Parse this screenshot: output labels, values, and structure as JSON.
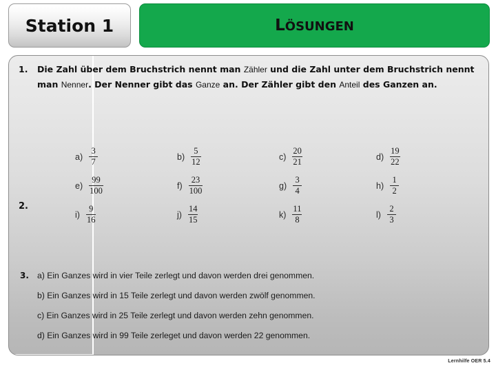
{
  "header": {
    "station_label": "Station 1",
    "solutions_label_first": "L",
    "solutions_label_rest": "ÖSUNGEN",
    "green_color": "#14a84c"
  },
  "section1": {
    "number": "1.",
    "text_part1": "Die Zahl über dem Bruchstrich nennt man ",
    "answer1": "Zähler",
    "text_part2": " und die Zahl unter dem Bruchstrich nennt man ",
    "answer2": "Nenner",
    "text_part3": ". Der Nenner gibt das ",
    "answer3": "Ganze",
    "text_part4": " an. Der Zähler gibt den ",
    "answer4": "Anteil",
    "text_part5": " des Ganzen an."
  },
  "section2": {
    "number": "2.",
    "rows": [
      [
        {
          "label": "a)",
          "numerator": "3",
          "denominator": "7"
        },
        {
          "label": "b)",
          "numerator": "5",
          "denominator": "12"
        },
        {
          "label": "c)",
          "numerator": "20",
          "denominator": "21"
        },
        {
          "label": "d)",
          "numerator": "19",
          "denominator": "22"
        }
      ],
      [
        {
          "label": "e)",
          "numerator": "99",
          "denominator": "100"
        },
        {
          "label": "f)",
          "numerator": "23",
          "denominator": "100"
        },
        {
          "label": "g)",
          "numerator": "3",
          "denominator": "4"
        },
        {
          "label": "h)",
          "numerator": "1",
          "denominator": "2"
        }
      ],
      [
        {
          "label": "i)",
          "numerator": "9",
          "denominator": "16"
        },
        {
          "label": "j)",
          "numerator": "14",
          "denominator": "15"
        },
        {
          "label": "k)",
          "numerator": "11",
          "denominator": "8"
        },
        {
          "label": "l)",
          "numerator": "2",
          "denominator": "3"
        }
      ]
    ]
  },
  "section3": {
    "number": "3.",
    "lines": [
      "a) Ein Ganzes wird in vier Teile zerlegt und davon werden drei genommen.",
      "b) Ein Ganzes wird in 15 Teile zerlegt und davon werden zwölf genommen.",
      "c) Ein Ganzes wird in 25 Teile zerlegt und davon werden zehn genommen.",
      "d) Ein Ganzes wird in 99 Teile zerleget und davon werden 22 genommen."
    ]
  },
  "footer": {
    "credit": "Lernhilfe OER 5.4"
  }
}
